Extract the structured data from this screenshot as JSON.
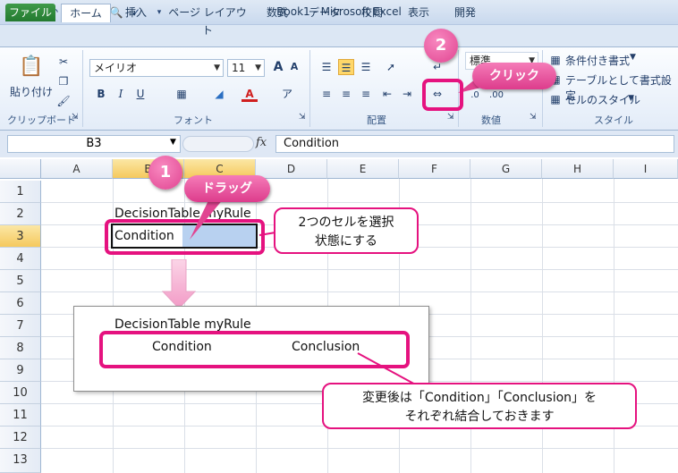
{
  "window": {
    "title": "Book1 - Microsoft Excel"
  },
  "ribbon_tabs": [
    "ファイル",
    "ホーム",
    "挿入",
    "ページ レイアウト",
    "数式",
    "データ",
    "校閲",
    "表示",
    "開発"
  ],
  "clipboard": {
    "paste_label": "貼り付け",
    "group_label": "クリップボード"
  },
  "font": {
    "name": "メイリオ",
    "size": "11",
    "group_label": "フォント",
    "grow": "A",
    "shrink": "A",
    "bold": "B",
    "italic": "I",
    "underline": "U",
    "font_color_letter": "A"
  },
  "alignment": {
    "group_label": "配置"
  },
  "number": {
    "format": "標準",
    "group_label": "数値"
  },
  "styles": {
    "cond_format": "条件付き書式",
    "table_format": "テーブルとして書式設定",
    "cell_styles": "セルのスタイル",
    "group_label": "スタイル"
  },
  "formula_bar": {
    "name_box": "B3",
    "fx": "fx",
    "value": "Condition"
  },
  "grid": {
    "columns": [
      "A",
      "B",
      "C",
      "D",
      "E",
      "F",
      "G",
      "H",
      "I"
    ],
    "rows": [
      "1",
      "2",
      "3",
      "4",
      "5",
      "6",
      "7",
      "8",
      "9",
      "10",
      "11",
      "12",
      "13"
    ],
    "b2": "DecisionTable myRule",
    "b3": "Condition"
  },
  "preview": {
    "title": "DecisionTable myRule",
    "condition": "Condition",
    "conclusion": "Conclusion"
  },
  "annotations": {
    "step1_number": "1",
    "step1_label": "ドラッグ",
    "step2_number": "2",
    "step2_label": "クリック",
    "select_note_line1": "2つのセルを選択",
    "select_note_line2": "状態にする",
    "merge_note_line1": "変更後は「Condition」「Conclusion」を",
    "merge_note_line2": "それぞれ結合しておきます"
  },
  "colors": {
    "accent": "#e5127f",
    "selected_header": "#f5c95d",
    "selection_fill": "#b8d1f0"
  }
}
